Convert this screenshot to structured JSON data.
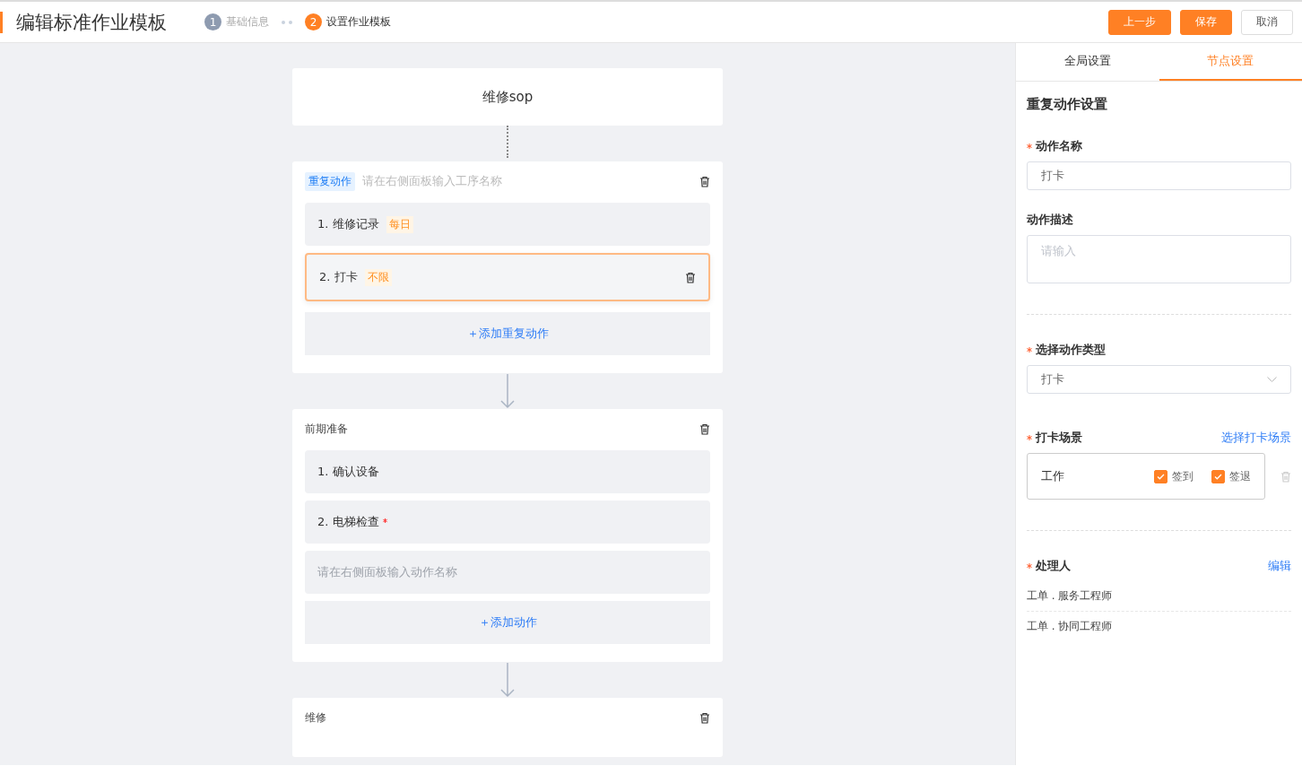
{
  "header": {
    "title": "编辑标准作业模板",
    "steps": [
      {
        "number": "1",
        "label": "基础信息",
        "selected": false
      },
      {
        "number": "2",
        "label": "设置作业模板",
        "selected": true
      }
    ],
    "buttons": [
      {
        "label": "上一步",
        "kind": "primary"
      },
      {
        "label": "保存",
        "kind": "primary"
      },
      {
        "label": "取消",
        "kind": "default"
      }
    ]
  },
  "flow": {
    "start": {
      "title": "维修sop"
    },
    "stages": [
      {
        "kind": "repeat",
        "tag": "重复动作",
        "title_placeholder": "请在右侧面板输入工序名称",
        "actions": [
          {
            "kind": "action",
            "label": "1. 维修记录",
            "tag": "每日",
            "required": false,
            "selected": false
          },
          {
            "kind": "action",
            "label": "2. 打卡",
            "tag": "不限",
            "required": false,
            "selected": true
          }
        ],
        "add_label": "＋添加重复动作"
      },
      {
        "kind": "process",
        "title": "前期准备",
        "actions": [
          {
            "kind": "action",
            "label": "1. 确认设备",
            "required": false,
            "selected": false
          },
          {
            "kind": "action",
            "label": "2. 电梯检查",
            "required": true,
            "selected": false
          },
          {
            "kind": "placeholder",
            "label": "请在右侧面板输入动作名称",
            "selected": false
          }
        ],
        "add_label": "＋添加动作"
      },
      {
        "kind": "process",
        "title": "维修"
      }
    ]
  },
  "panel": {
    "tabs": [
      {
        "label": "全局设置",
        "selected": false
      },
      {
        "label": "节点设置",
        "selected": true
      }
    ],
    "section_title": "重复动作设置",
    "action_name": {
      "label": "动作名称",
      "required": true,
      "value": "打卡"
    },
    "action_description": {
      "label": "动作描述",
      "required": false,
      "placeholder": "请输入"
    },
    "action_type": {
      "label": "选择动作类型",
      "required": true,
      "value": "打卡"
    },
    "checkin_scene": {
      "label": "打卡场景",
      "required": true,
      "link": "选择打卡场景",
      "scenes": [
        {
          "name": "工作",
          "options": [
            {
              "label": "签到",
              "checked": true
            },
            {
              "label": "签退",
              "checked": true
            }
          ]
        }
      ]
    },
    "handlers": {
      "label": "处理人",
      "required": true,
      "link": "编辑",
      "items": [
        "工单 . 服务工程师",
        "工单 . 协同工程师"
      ]
    }
  }
}
